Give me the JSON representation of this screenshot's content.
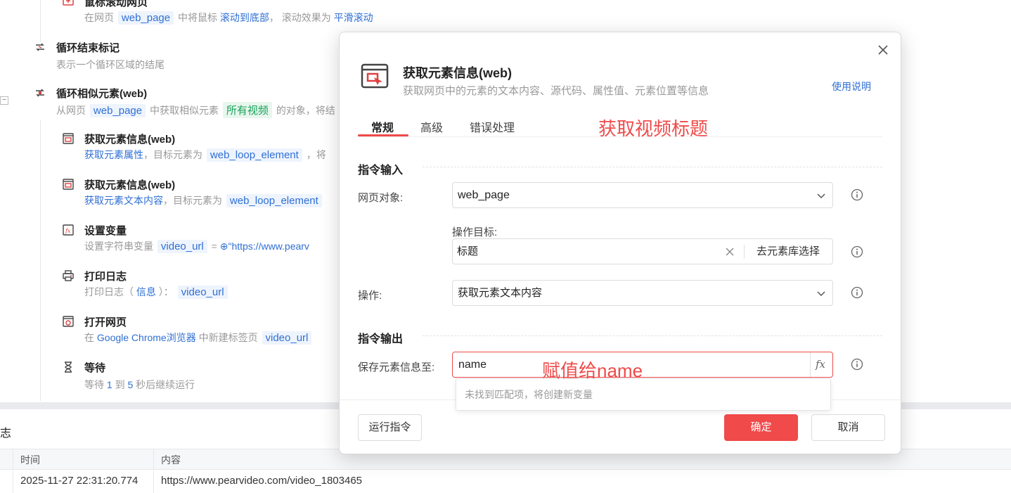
{
  "flow": {
    "scroll_step": {
      "title": "鼠标滚动网页",
      "desc_prefix": "在网页",
      "var": "web_page",
      "mid": "中将鼠标",
      "action": "滚动到底部",
      "sep": "，",
      "effect_label": "滚动效果为",
      "effect": "平滑滚动"
    },
    "loop_end": {
      "title": "循环结束标记",
      "desc": "表示一个循环区域的结尾"
    },
    "loop_similar": {
      "title": "循环相似元素(web)",
      "desc_prefix": "从网页",
      "var": "web_page",
      "mid": "中获取相似元素",
      "target": "所有视频",
      "suffix": "的对象，将结"
    },
    "get_info_1": {
      "title": "获取元素信息(web)",
      "action": "获取元素属性",
      "mid": "，目标元素为",
      "var": "web_loop_element",
      "suffix": "，将"
    },
    "get_info_2": {
      "title": "获取元素信息(web)",
      "action": "获取元素文本内容",
      "mid": "，目标元素为",
      "var": "web_loop_element"
    },
    "set_var": {
      "title": "设置变量",
      "desc_prefix": "设置字符串变量",
      "var": "video_url",
      "eq": "=",
      "value": "\"https://www.pearv"
    },
    "print_log": {
      "title": "打印日志",
      "desc_prefix": "打印日志（",
      "level": "信息",
      "mid": "）：",
      "var": "video_url"
    },
    "open_page": {
      "title": "打开网页",
      "desc_prefix": "在",
      "browser": "Google Chrome浏览器",
      "mid": "中新建标签页",
      "var": "video_url"
    },
    "wait": {
      "title": "等待",
      "p1": "等待",
      "from": "1",
      "p2": "到",
      "to": "5",
      "p3": "秒后继续运行"
    },
    "collapse_symbol": "−"
  },
  "log": {
    "title": "志",
    "columns": [
      "时间",
      "内容"
    ],
    "rows": [
      {
        "time": "2025-11-27 22:31:20.774",
        "content": "https://www.pearvideo.com/video_1803465"
      }
    ]
  },
  "dialog": {
    "title": "获取元素信息(web)",
    "subtitle": "获取网页中的元素的文本内容、源代码、属性值、元素位置等信息",
    "help_link": "使用说明",
    "tabs": [
      "常规",
      "高级",
      "错误处理"
    ],
    "annotation_top": "获取视频标题",
    "section_input": "指令输入",
    "page_label": "网页对象:",
    "page_value": "web_page",
    "target_label": "操作目标:",
    "target_value": "标题",
    "target_pick": "去元素库选择",
    "op_label": "操作:",
    "op_value": "获取元素文本内容",
    "section_output": "指令输出",
    "save_label": "保存元素信息至:",
    "save_value": "name",
    "fx_label": "fx",
    "annotation_save": "赋值给name",
    "suggestion": "未找到匹配项，将创建新变量",
    "run_button": "运行指令",
    "ok_button": "确定",
    "cancel_button": "取消"
  },
  "colors": {
    "accent": "#f04a4a",
    "link": "#2f6fd4",
    "tag_bg": "#eef4fd",
    "green": "#19a25a"
  }
}
